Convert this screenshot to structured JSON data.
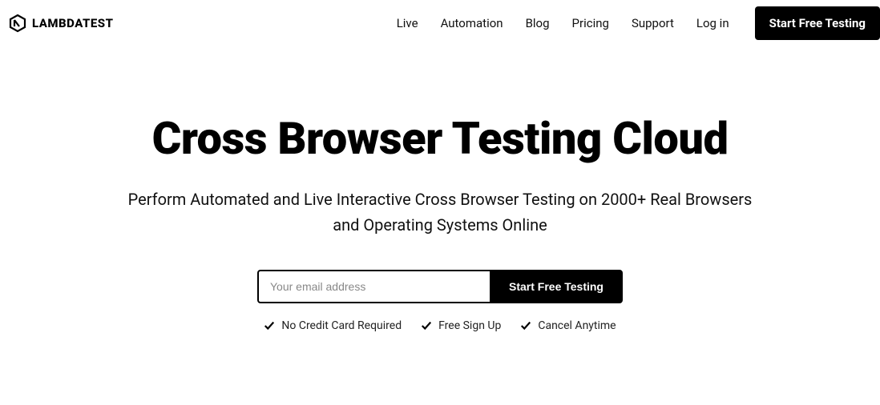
{
  "header": {
    "logo_text": "LAMBDATEST",
    "nav_links": [
      "Live",
      "Automation",
      "Blog",
      "Pricing",
      "Support",
      "Log in"
    ],
    "cta_label": "Start Free Testing"
  },
  "hero": {
    "title": "Cross Browser Testing Cloud",
    "subtitle": "Perform Automated and Live Interactive Cross Browser Testing on 2000+ Real Browsers and Operating Systems Online",
    "email_placeholder": "Your email address",
    "cta_label": "Start Free Testing",
    "benefits": [
      "No Credit Card Required",
      "Free Sign Up",
      "Cancel Anytime"
    ]
  }
}
